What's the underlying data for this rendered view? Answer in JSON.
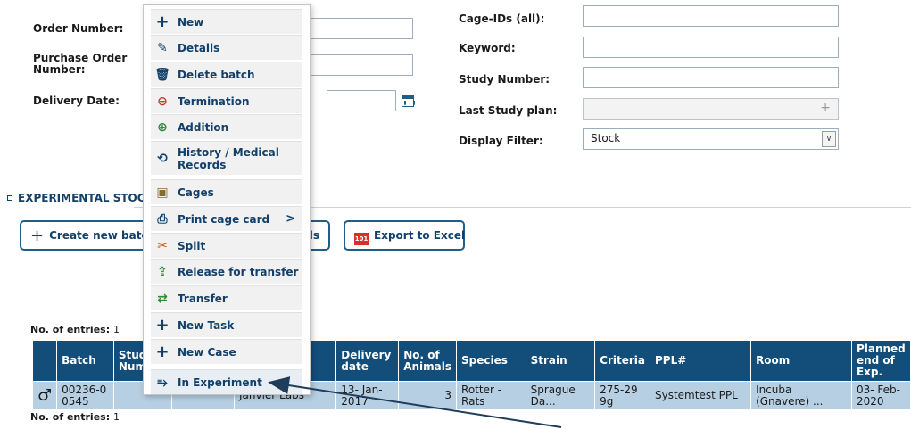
{
  "form": {
    "order_number_label": "Order Number:",
    "purchase_order_label": "Purchase Order Number:",
    "delivery_date_label": "Delivery Date:",
    "cage_ids_label": "Cage-IDs (all):",
    "keyword_label": "Keyword:",
    "study_number_label": "Study Number:",
    "last_study_plan_label": "Last Study plan:",
    "display_filter_label": "Display Filter:",
    "display_filter_value": "Stock",
    "last_study_plan_plus": "+",
    "dropdown_arrow": "∨"
  },
  "section": {
    "title": "EXPERIMENTAL STOCK"
  },
  "toolbar": {
    "create_batch": "Create new batch",
    "cards_fragment": "ds",
    "export_excel": "Export to Excel"
  },
  "entries": {
    "label": "No. of entries:",
    "count": "1"
  },
  "table": {
    "headers": [
      "Batch",
      "Study Number",
      "",
      "",
      "Delivery date",
      "No. of Animals",
      "Species",
      "Strain",
      "Criteria",
      "PPL#",
      "Room",
      "Planned end of Exp."
    ],
    "row": {
      "sex_symbol": "♂",
      "batch": "00236-0 0545",
      "study_number": "",
      "col3": "",
      "supplier": "Janvier Labs",
      "delivery_date": "13- Jan-2017",
      "animals": "3",
      "species": "Rotter - Rats",
      "strain": "Sprague Da...",
      "criteria": "275-29 9g",
      "ppl": "Systemtest PPL",
      "room": "Incuba (Gnavere) ...",
      "planned_end": "03- Feb-2020"
    }
  },
  "menu": {
    "items": [
      {
        "label": "New",
        "icon": "plus-icon"
      },
      {
        "label": "Details",
        "icon": "pencil-icon"
      },
      {
        "label": "Delete batch",
        "icon": "trash-icon"
      },
      {
        "label": "Termination",
        "icon": "termination-icon"
      },
      {
        "label": "Addition",
        "icon": "addition-icon"
      },
      {
        "label": "History / Medical Records",
        "icon": "history-icon"
      },
      {
        "label": "Cages",
        "icon": "cage-icon"
      },
      {
        "label": "Print cage card",
        "icon": "printer-icon",
        "submenu": ">"
      },
      {
        "label": "Split",
        "icon": "split-icon"
      },
      {
        "label": "Release for transfer",
        "icon": "release-icon"
      },
      {
        "label": "Transfer",
        "icon": "transfer-icon"
      },
      {
        "label": "New Task",
        "icon": "plus-icon"
      },
      {
        "label": "New Case",
        "icon": "plus-icon"
      },
      {
        "label": "In Experiment",
        "icon": "experiment-icon"
      }
    ]
  },
  "colors": {
    "header_bg": "#134d7a",
    "row_bg": "#b6cfe3",
    "accent": "#13406a",
    "arrow": "#1f3d5a"
  }
}
